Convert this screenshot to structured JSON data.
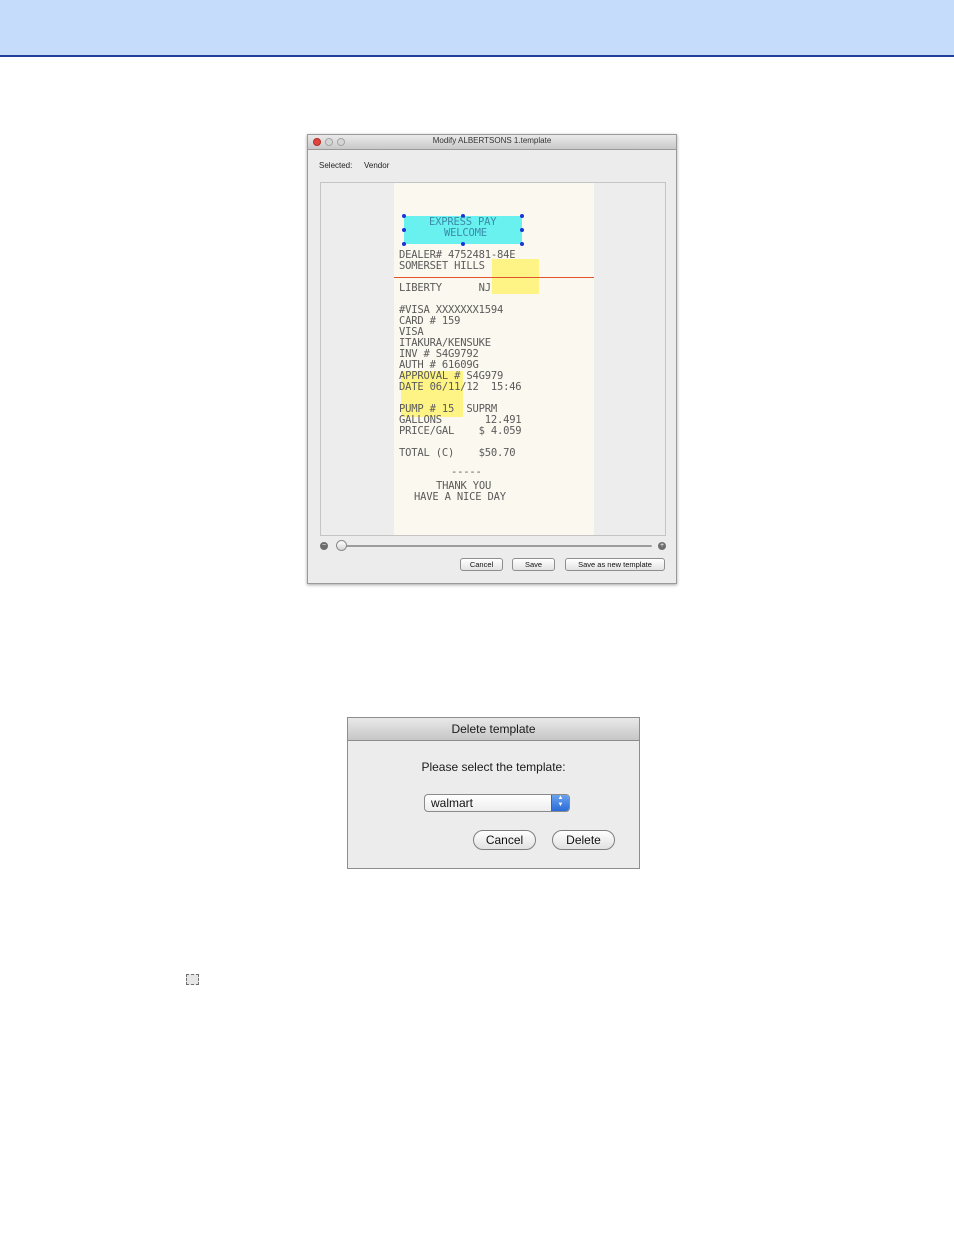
{
  "modify_window": {
    "title": "Modify ALBERTSONS 1.template",
    "selected_label": "Selected:",
    "selected_value": "Vendor",
    "receipt_lines": [
      "EXPRESS PAY",
      "WELCOME",
      "DEALER# 4752481-84E",
      "SOMERSET HILLS",
      "LIBERTY      NJ",
      "#VISA XXXXXXX1594",
      "CARD # 159",
      "VISA",
      "ITAKURA/KENSUKE",
      "INV # S4G9792",
      "AUTH # 61609G",
      "APPROVAL # S4G979",
      "DATE 06/11/12  15:46",
      "PUMP # 15  SUPRM",
      "GALLONS       12.491",
      "PRICE/GAL    $ 4.059",
      "TOTAL (C)    $50.70",
      "-----",
      "THANK YOU",
      "HAVE A NICE DAY"
    ],
    "zoom_level": 0.0,
    "buttons": {
      "cancel": "Cancel",
      "save": "Save",
      "save_new": "Save as new template"
    }
  },
  "delete_dialog": {
    "title": "Delete template",
    "prompt": "Please select the template:",
    "selected_template": "walmart",
    "buttons": {
      "cancel": "Cancel",
      "delete": "Delete"
    }
  },
  "colors": {
    "header_band": "#c5dcfb",
    "header_rule": "#1f3f9a",
    "selection_highlight": "#4ff0f0",
    "field_highlight": "#fff25a",
    "handle": "#1a35d6",
    "divider_line": "#e3542c"
  },
  "icons": {
    "inline_icon": "marquee-select-icon"
  }
}
